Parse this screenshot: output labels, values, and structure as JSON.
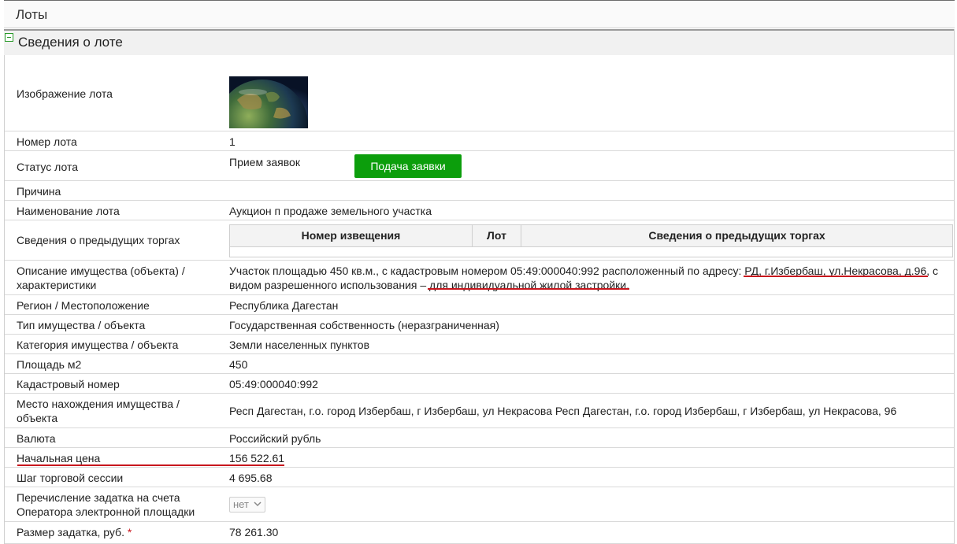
{
  "page": {
    "title": "Лоты"
  },
  "section": {
    "title": "Сведения о лоте"
  },
  "rows": {
    "image": {
      "label": "Изображение лота"
    },
    "lot_number": {
      "label": "Номер лота",
      "value": "1"
    },
    "status": {
      "label": "Статус лота",
      "value": "Прием заявок",
      "button": "Подача заявки"
    },
    "reason": {
      "label": "Причина",
      "value": ""
    },
    "name": {
      "label": "Наименование лота",
      "value": "Аукцион п продаже земельного участка"
    },
    "prev_auctions": {
      "label": "Сведения о предыдущих торгах",
      "columns": [
        "Номер извещения",
        "Лот",
        "Сведения о предыдущих торгах"
      ]
    },
    "description": {
      "label": "Описание имущества (объекта) / характеристики",
      "value": "Участок площадью 450 кв.м., с кадастровым номером 05:49:000040:992 расположенный по адресу: РД, г.Избербаш, ул.Некрасова, д.96, с видом разрешенного использования – для индивидуальной жилой застройки."
    },
    "region": {
      "label": "Регион / Местоположение",
      "value": "Республика Дагестан"
    },
    "property_type": {
      "label": "Тип имущества / объекта",
      "value": "Государственная собственность (неразграниченная)"
    },
    "category": {
      "label": "Категория имущества / объекта",
      "value": "Земли населенных пунктов"
    },
    "area": {
      "label": "Площадь м2",
      "value": "450"
    },
    "cadastral": {
      "label": "Кадастровый номер",
      "value": "05:49:000040:992"
    },
    "location": {
      "label": "Место нахождения имущества / объекта",
      "value": "Респ Дагестан, г.о. город Избербаш, г Избербаш, ул Некрасова Респ Дагестан, г.о. город Избербаш, г Избербаш, ул Некрасова, 96"
    },
    "currency": {
      "label": "Валюта",
      "value": "Российский рубль"
    },
    "start_price": {
      "label": "Начальная цена",
      "value": "156 522.61"
    },
    "step": {
      "label": "Шаг торговой сессии",
      "value": "4 695.68"
    },
    "deposit_transfer": {
      "label": "Перечисление задатка на счета Оператора электронной площадки",
      "value": "нет"
    },
    "deposit_size": {
      "label": "Размер задатка, руб.",
      "required_mark": "*",
      "value": "78 261.30"
    }
  },
  "colors": {
    "accent_button": "#0c9e0c",
    "underline": "#c8161d"
  },
  "icons": {
    "collapse": "minus-square-icon",
    "dropdown": "chevron-down-icon"
  }
}
